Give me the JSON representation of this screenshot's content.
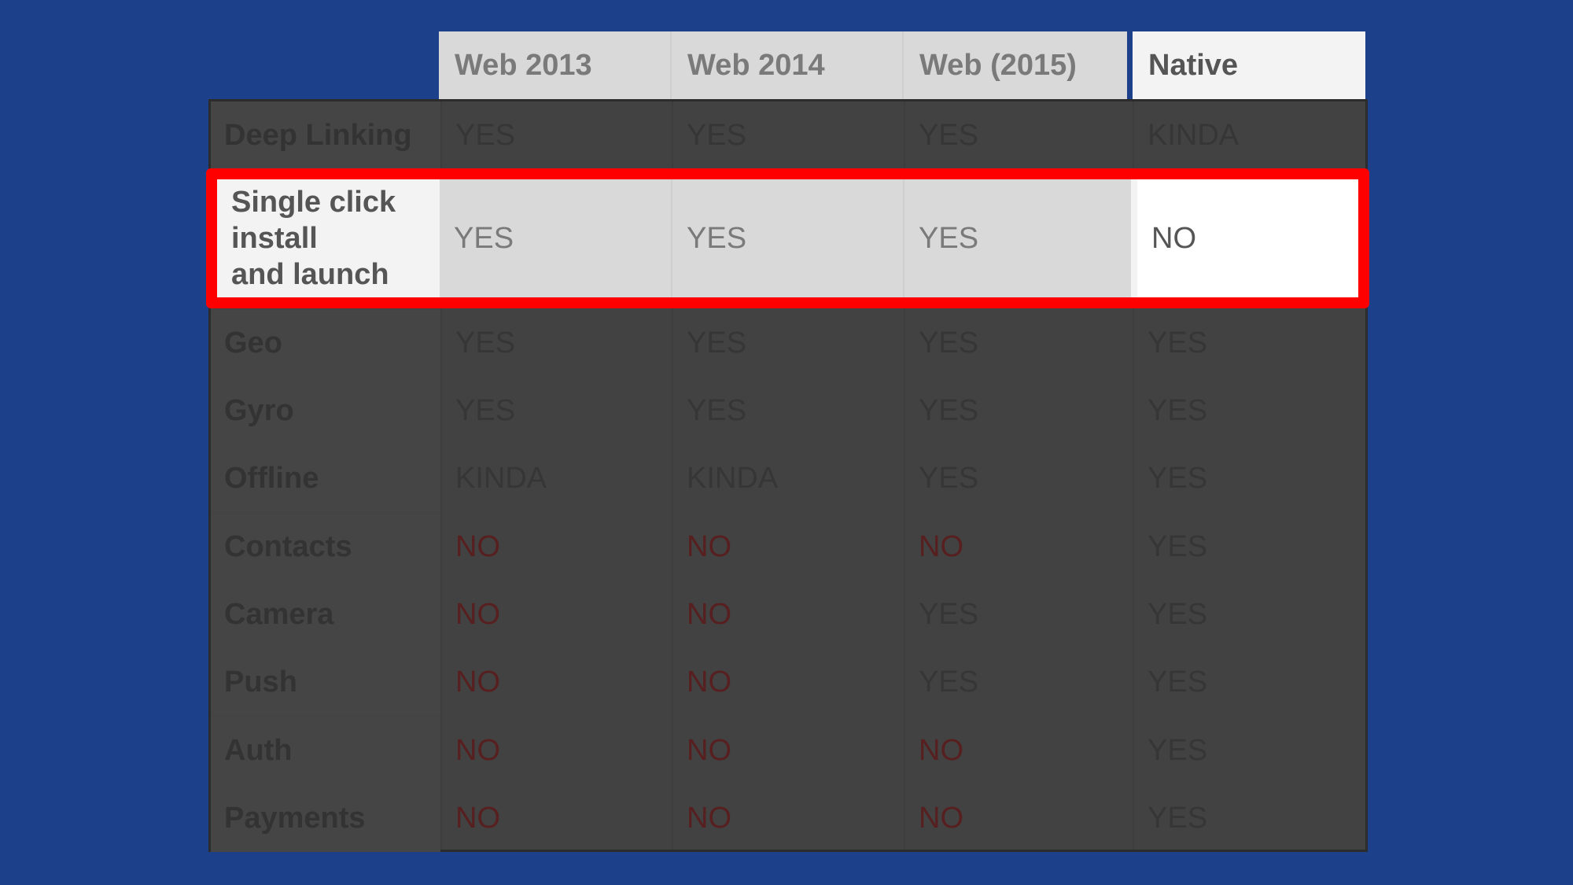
{
  "table": {
    "headers": [
      "Web 2013",
      "Web 2014",
      "Web (2015)",
      "Native"
    ],
    "highlighted_row": {
      "label": "Single click\ninstall\nand launch",
      "values": [
        "YES",
        "YES",
        "YES",
        "NO"
      ]
    },
    "rows": [
      {
        "label": "Deep Linking",
        "values": [
          "YES",
          "YES",
          "YES",
          "KINDA"
        ]
      },
      {
        "label": "Geo",
        "values": [
          "YES",
          "YES",
          "YES",
          "YES"
        ]
      },
      {
        "label": "Gyro",
        "values": [
          "YES",
          "YES",
          "YES",
          "YES"
        ]
      },
      {
        "label": "Offline",
        "values": [
          "KINDA",
          "KINDA",
          "YES",
          "YES"
        ]
      },
      {
        "label": "Contacts",
        "values": [
          "NO",
          "NO",
          "NO",
          "YES"
        ]
      },
      {
        "label": "Camera",
        "values": [
          "NO",
          "NO",
          "YES",
          "YES"
        ]
      },
      {
        "label": "Push",
        "values": [
          "NO",
          "NO",
          "YES",
          "YES"
        ]
      },
      {
        "label": "Auth",
        "values": [
          "NO",
          "NO",
          "NO",
          "YES"
        ]
      },
      {
        "label": "Payments",
        "values": [
          "NO",
          "NO",
          "NO",
          "YES"
        ]
      }
    ]
  },
  "colors": {
    "background": "#1c418a",
    "highlight_border": "#ff0000",
    "dim_overlay": "#424242",
    "no_text_dimmed": "#571f1f"
  }
}
